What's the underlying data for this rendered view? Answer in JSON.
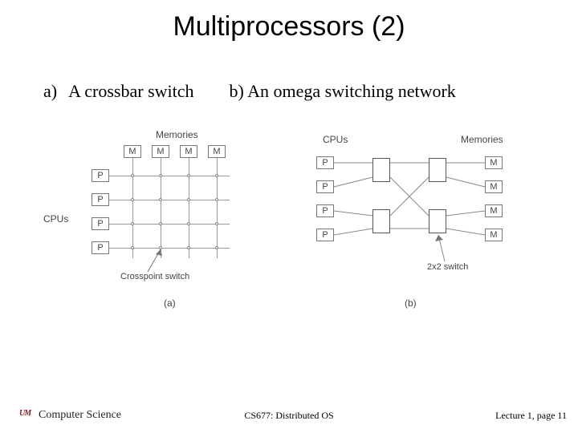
{
  "title": "Multiprocessors (2)",
  "caption_a_prefix": "a)",
  "caption_a": "A crossbar switch",
  "caption_b": "b) An omega switching network",
  "fig_a": {
    "top_label": "Memories",
    "side_label": "CPUs",
    "row_label": "P",
    "col_label": "M",
    "annotation": "Crosspoint switch",
    "fig_id": "(a)"
  },
  "fig_b": {
    "left_label": "CPUs",
    "right_label": "Memories",
    "row_label": "P",
    "mem_label": "M",
    "annotation": "2x2 switch",
    "fig_id": "(b)"
  },
  "footer": {
    "dept": "Computer Science",
    "course": "CS677: Distributed OS",
    "page": "Lecture 1, page 11"
  }
}
